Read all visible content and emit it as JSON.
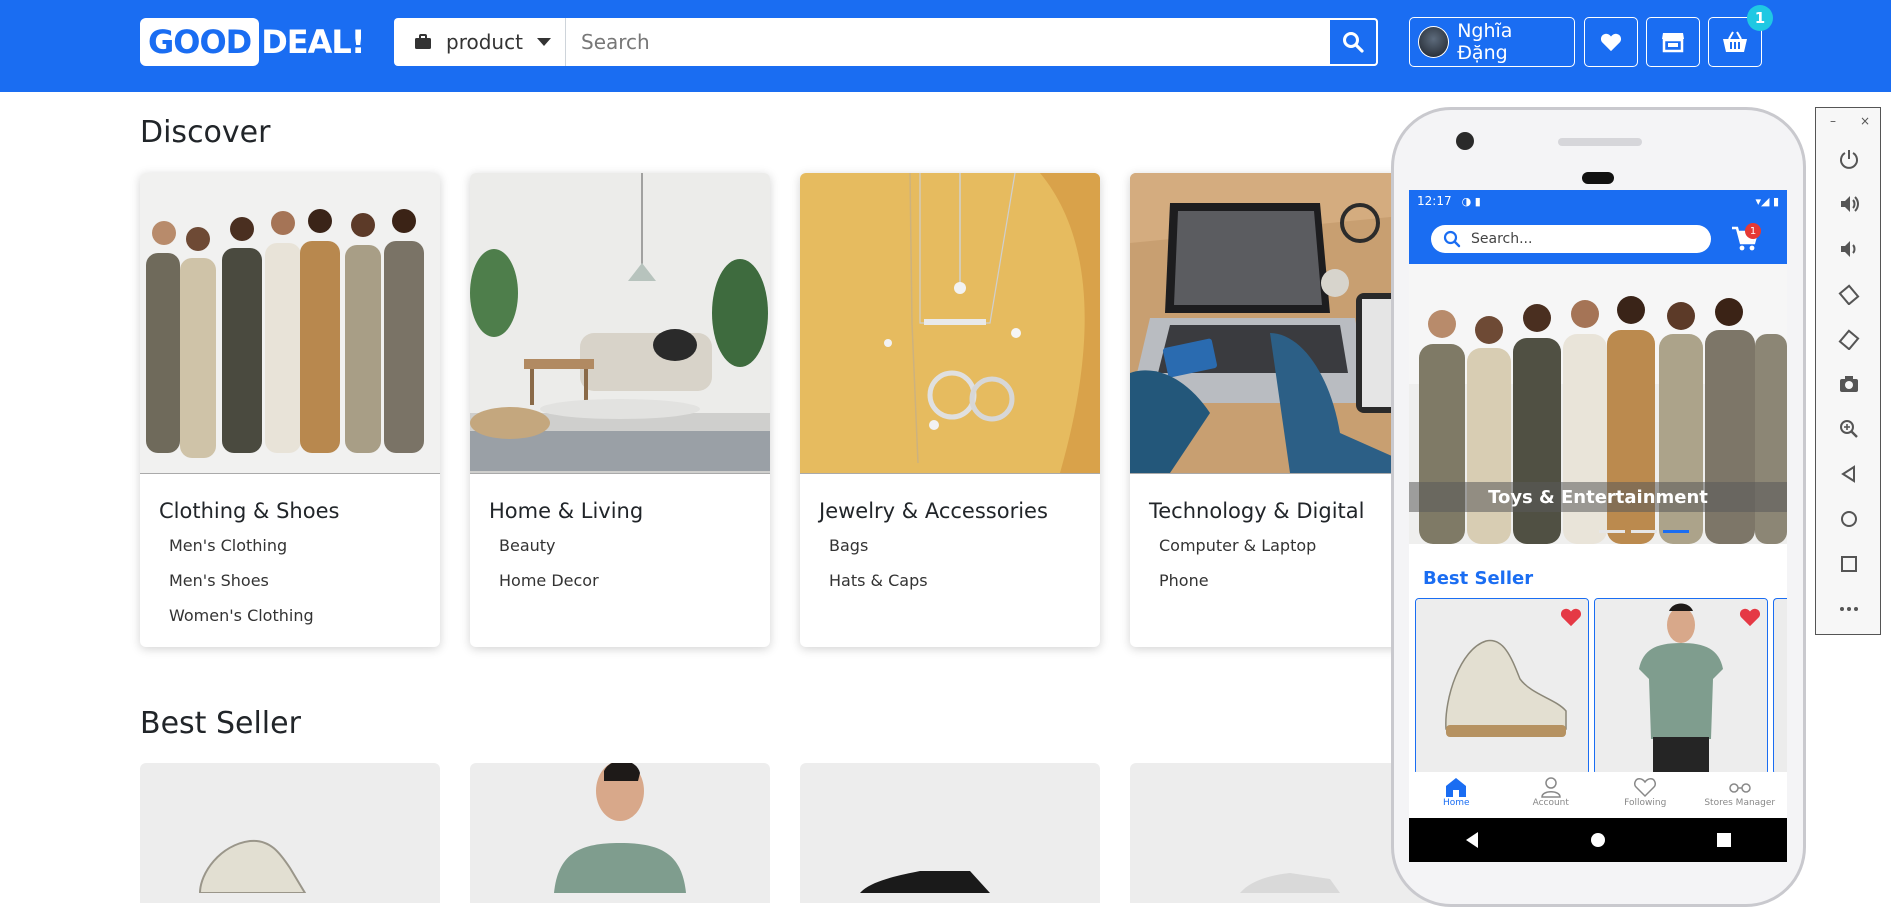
{
  "header": {
    "logo_part1": "GOOD",
    "logo_part2": "DEAL!",
    "category_select": "product",
    "search_placeholder": "Search",
    "user_name": "Nghĩa Đặng",
    "cart_count": "1"
  },
  "discover": {
    "title": "Discover",
    "categories": [
      {
        "title": "Clothing & Shoes",
        "subs": [
          "Men's Clothing",
          "Men's Shoes",
          "Women's Clothing"
        ]
      },
      {
        "title": "Home & Living",
        "subs": [
          "Beauty",
          "Home Decor"
        ]
      },
      {
        "title": "Jewelry & Accessories",
        "subs": [
          "Bags",
          "Hats & Caps"
        ]
      },
      {
        "title": "Technology & Digital",
        "subs": [
          "Computer & Laptop",
          "Phone"
        ]
      }
    ]
  },
  "best_seller": {
    "title": "Best Seller"
  },
  "phone": {
    "time": "12:17",
    "search_placeholder": "Search...",
    "cart_badge": "1",
    "banner_label": "Toys & Entertainment",
    "best_seller_title": "Best Seller",
    "nav": [
      "Home",
      "Account",
      "Following",
      "Stores Manager"
    ]
  },
  "colors": {
    "primary": "#1a6df2",
    "badge": "#1fc8e3",
    "heart": "#e53945"
  }
}
